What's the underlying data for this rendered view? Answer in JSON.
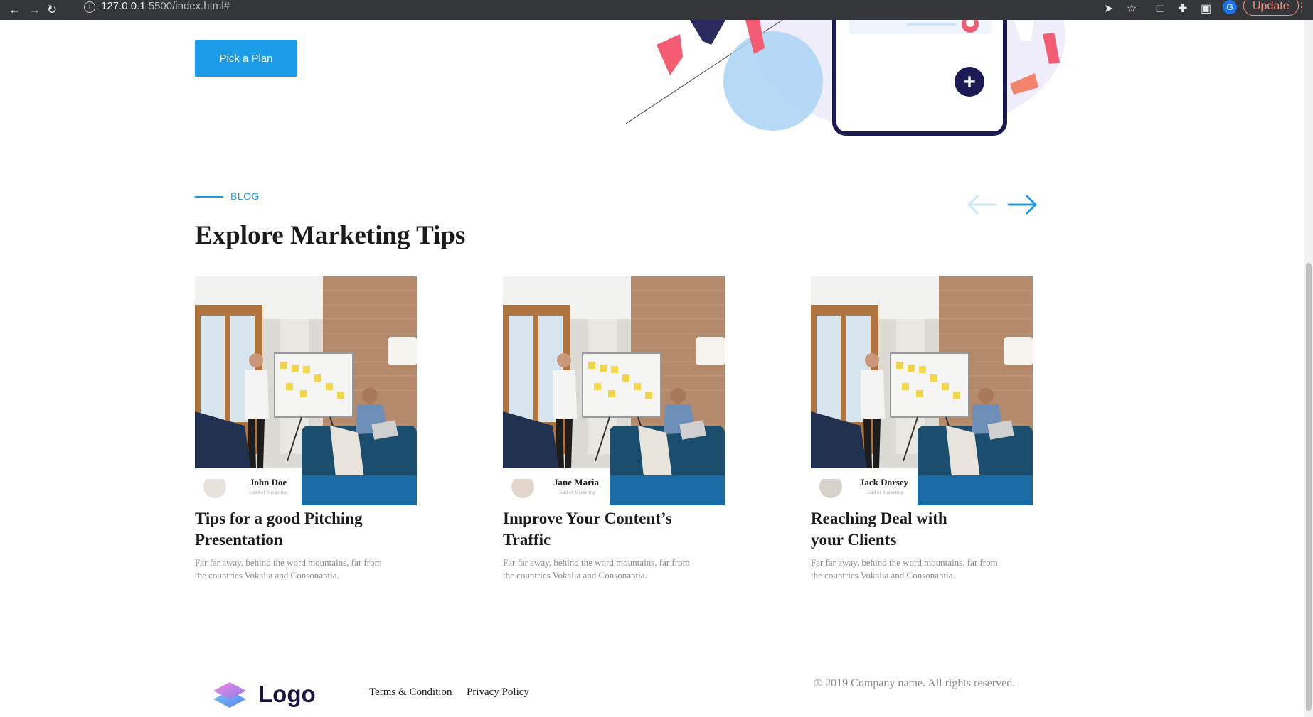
{
  "browser": {
    "url_host": "127.0.0.1",
    "url_path": ":5500/index.html#",
    "profile_initial": "G",
    "update_label": "Update"
  },
  "hero": {
    "cta_label": "Pick a Plan"
  },
  "blog": {
    "eyebrow": "BLOG",
    "title": "Explore Marketing Tips",
    "posts": [
      {
        "author_name": "John Doe",
        "author_role": "Head of Marketing",
        "title": "Tips for a good Pitching Presentation",
        "excerpt": "Far far away, behind the word mountains, far from the countries Vokalia and Consonantia."
      },
      {
        "author_name": "Jane Maria",
        "author_role": "Head of Marketing",
        "title": "Improve Your Content’s Traffic",
        "excerpt": "Far far away, behind the word mountains, far from the countries Vokalia and Consonantia."
      },
      {
        "author_name": "Jack Dorsey",
        "author_role": "Head of Marketing",
        "title": "Reaching Deal with your Clients",
        "excerpt": "Far far away, behind the word mountains, far from the countries Vokalia and Consonantia."
      }
    ]
  },
  "footer": {
    "logo_text": "Logo",
    "links": [
      "Terms & Condition",
      "Privacy Policy"
    ],
    "copyright": "® 2019 Company name. All rights reserved."
  },
  "colors": {
    "accent": "#1c9ce8",
    "heading": "#1b1b1b",
    "muted": "#8a8a8a",
    "logo": "#1b1240"
  }
}
